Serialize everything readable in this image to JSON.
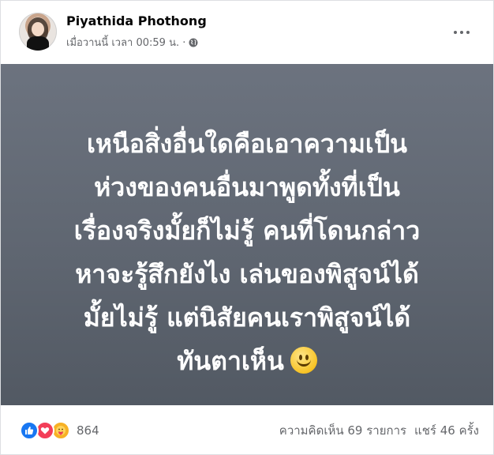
{
  "post": {
    "author": "Piyathida Phothong",
    "timestamp": "เมื่อวานนี้ เวลา 00:59 น. ·",
    "privacy_icon": "globe-icon",
    "more_icon": "more-options-icon",
    "text_lines": [
      "เหนือสิ่งอื่นใดคือเอาความเป็น",
      "ห่วงของคนอื่นมาพูดทั้งที่เป็น",
      "เรื่องจริงมั้ยก็ไม่รู้ คนที่โดนกล่าว",
      "หาจะรู้สึกยังไง เล่นของพิสูจน์ได้",
      "มั้ยไม่รู้ แต่นิสัยคนเราพิสูจน์ได้",
      "ทันตาเห็น"
    ],
    "background_color": "#5f6671"
  },
  "footer": {
    "reaction_icons": [
      "like-icon",
      "love-icon",
      "care-icon"
    ],
    "reaction_count": "864",
    "comments": "ความคิดเห็น 69 รายการ",
    "shares": "แชร์ 46 ครั้ง"
  }
}
